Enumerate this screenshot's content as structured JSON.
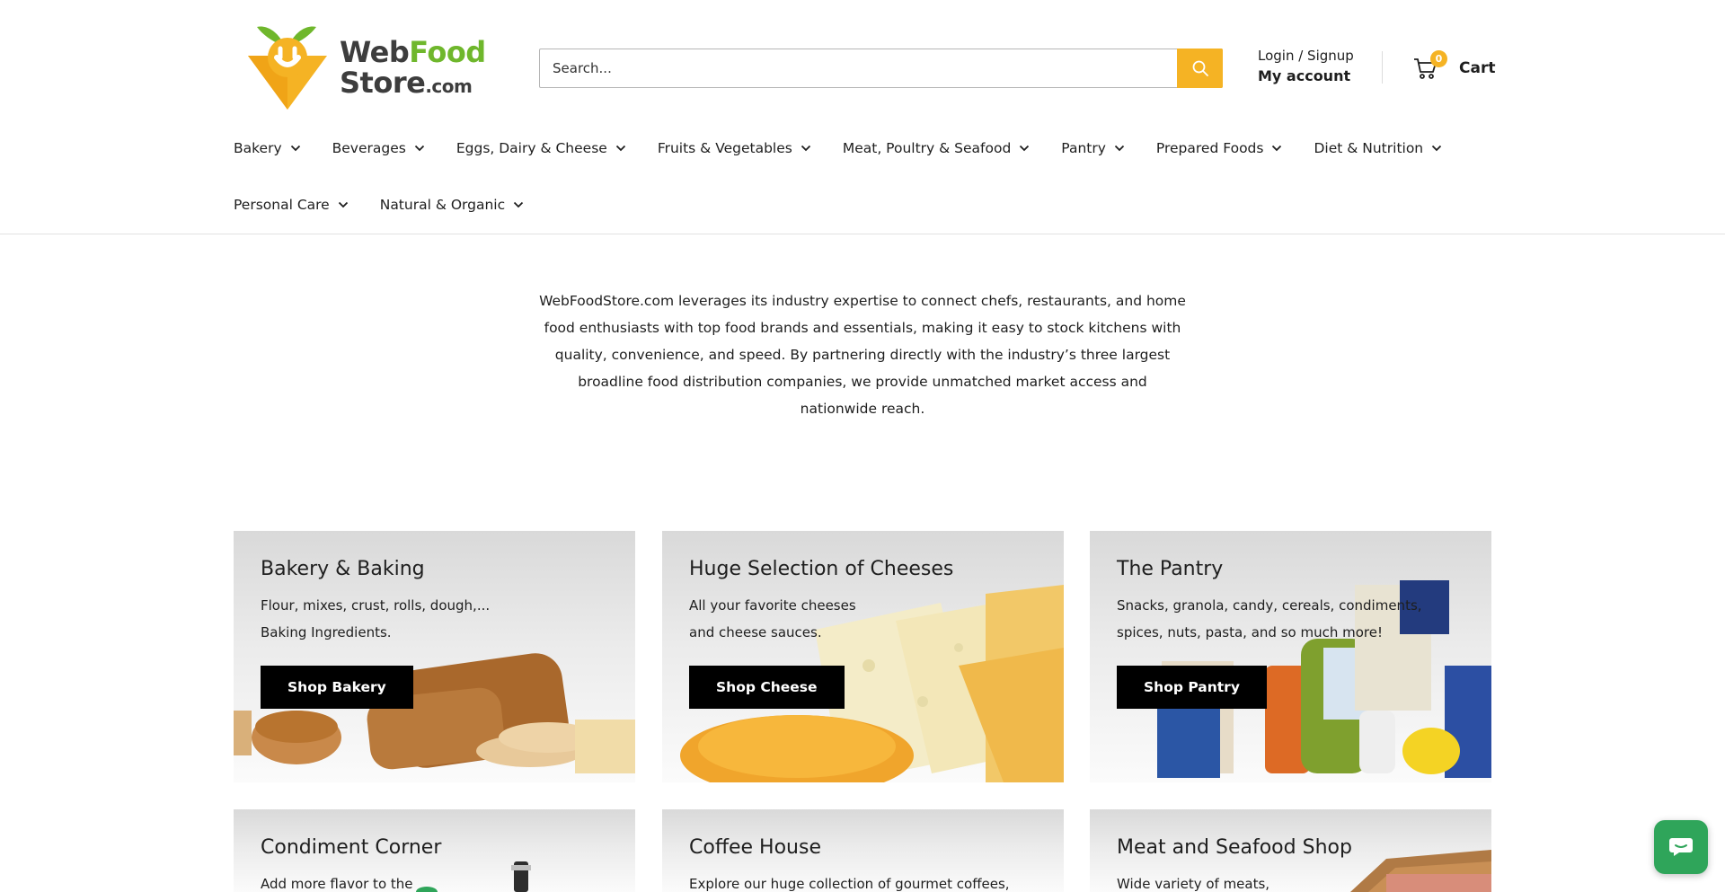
{
  "brand": {
    "logo_web": "Web",
    "logo_food": "Food",
    "logo_store": "Store",
    "logo_com": ".com",
    "colors": {
      "accent": "#f5b324",
      "green": "#6fb72c",
      "button": "#000000",
      "chat": "#2fa55a"
    }
  },
  "search": {
    "placeholder": "Search...",
    "icon": "search-icon"
  },
  "account": {
    "login_label": "Login / Signup",
    "my_account_label": "My account"
  },
  "cart": {
    "count": "0",
    "label": "Cart",
    "icon": "cart-icon"
  },
  "nav": {
    "items": [
      {
        "label": "Bakery"
      },
      {
        "label": "Beverages"
      },
      {
        "label": "Eggs, Dairy & Cheese"
      },
      {
        "label": "Fruits & Vegetables"
      },
      {
        "label": "Meat, Poultry & Seafood"
      },
      {
        "label": "Pantry"
      },
      {
        "label": "Prepared Foods"
      },
      {
        "label": "Diet & Nutrition"
      },
      {
        "label": "Personal Care"
      },
      {
        "label": "Natural & Organic"
      }
    ]
  },
  "intro": {
    "text": "WebFoodStore.com leverages its industry expertise to connect chefs, restaurants, and home food enthusiasts with top food brands and essentials, making it easy to stock kitchens with quality, convenience, and speed. By partnering directly with the industry’s three largest broadline food distribution companies, we provide unmatched market access and nationwide reach."
  },
  "cards": [
    {
      "title": "Bakery & Baking",
      "desc_line1": "Flour, mixes, crust, rolls, dough,...",
      "desc_line2": "Baking Ingredients.",
      "button": "Shop Bakery"
    },
    {
      "title": "Huge Selection of Cheeses",
      "desc_line1": "All your favorite cheeses",
      "desc_line2": "and cheese sauces.",
      "button": "Shop Cheese"
    },
    {
      "title": "The Pantry",
      "desc_line1": "Snacks, granola, candy, cereals, condiments,",
      "desc_line2": "spices, nuts, pasta, and so much more!",
      "button": "Shop Pantry"
    },
    {
      "title": "Condiment Corner",
      "desc_line1": "Add more flavor to the",
      "desc_line2": ""
    },
    {
      "title": "Coffee House",
      "desc_line1": "Explore our huge collection of gourmet coffees,",
      "desc_line2": ""
    },
    {
      "title": "Meat and Seafood Shop",
      "desc_line1": "Wide variety of meats,",
      "desc_line2": ""
    }
  ],
  "chat": {
    "icon": "chat-icon"
  }
}
